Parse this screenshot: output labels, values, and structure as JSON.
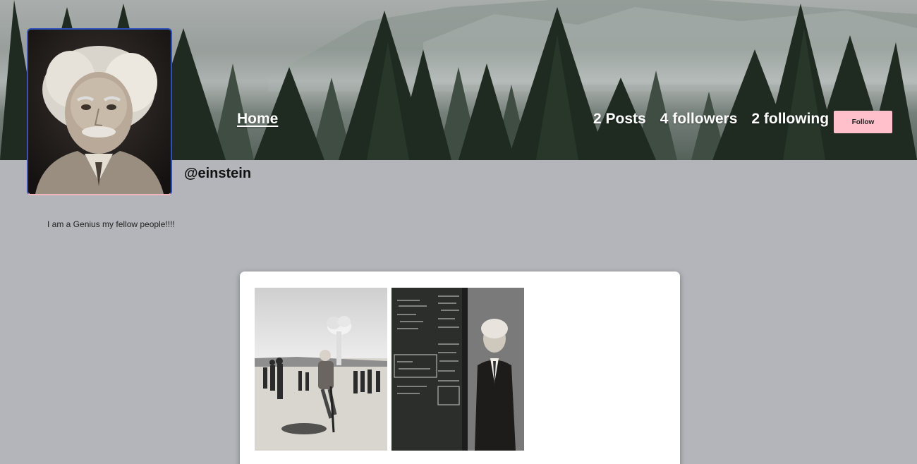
{
  "nav": {
    "home_label": "Home"
  },
  "profile": {
    "handle": "@einstein",
    "bio": "I am a Genius my fellow people!!!!",
    "avatar_icon": "profile-photo-einstein"
  },
  "stats": {
    "posts": "2 Posts",
    "followers": "4 followers",
    "following": "2 following"
  },
  "actions": {
    "follow_label": "Follow"
  },
  "colors": {
    "page_background": "#b3b5ba",
    "follow_button": "#ffc0cb",
    "card_background": "#ffffff"
  },
  "posts": [
    {
      "images": [
        {
          "icon": "photo-bicycle-mushroom-cloud"
        },
        {
          "icon": "photo-chalkboard-lecture"
        }
      ]
    }
  ]
}
